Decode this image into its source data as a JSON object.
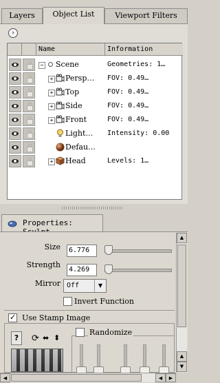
{
  "tabs": [
    {
      "label": "Layers"
    },
    {
      "label": "Object List"
    },
    {
      "label": "Viewport Filters"
    }
  ],
  "object_list": {
    "nav_icon": "chevron-right-icon",
    "columns": {
      "name": "Name",
      "information": "Information"
    },
    "rows": [
      {
        "name": "Scene",
        "info": "Geometries: 1…",
        "icon": "scene-icon",
        "expander": "−"
      },
      {
        "name": "Persp…",
        "info": "FOV: 0.49…",
        "icon": "camera-icon",
        "expander": "+"
      },
      {
        "name": "Top",
        "info": "FOV: 0.49…",
        "icon": "camera-icon",
        "expander": "+"
      },
      {
        "name": "Side",
        "info": "FOV: 0.49…",
        "icon": "camera-icon",
        "expander": "+"
      },
      {
        "name": "Front",
        "info": "FOV: 0.49…",
        "icon": "camera-icon",
        "expander": "+"
      },
      {
        "name": "Light…",
        "info": "Intensity: 0.00",
        "icon": "light-bulb-icon",
        "expander": ""
      },
      {
        "name": "Defau…",
        "info": "",
        "icon": "material-sphere-icon",
        "expander": ""
      },
      {
        "name": "Head",
        "info": "Levels: 1…",
        "icon": "mesh-cube-icon",
        "expander": "+"
      }
    ]
  },
  "properties": {
    "title": "Properties: Sculpt",
    "size_label": "Size",
    "size_value": "6.776",
    "strength_label": "Strength",
    "strength_value": "4.269",
    "mirror_label": "Mirror",
    "mirror_value": "Off",
    "invert_label": "Invert Function",
    "invert_checked": false,
    "stamp_label": "Use Stamp Image",
    "stamp_checked": true,
    "randomize_label": "Randomize",
    "randomize_checked": false,
    "help_label": "?"
  },
  "colors": {
    "panel": "#d4d0c8",
    "tree_bg": "#ffffff",
    "accent": "#4a6fb0"
  }
}
